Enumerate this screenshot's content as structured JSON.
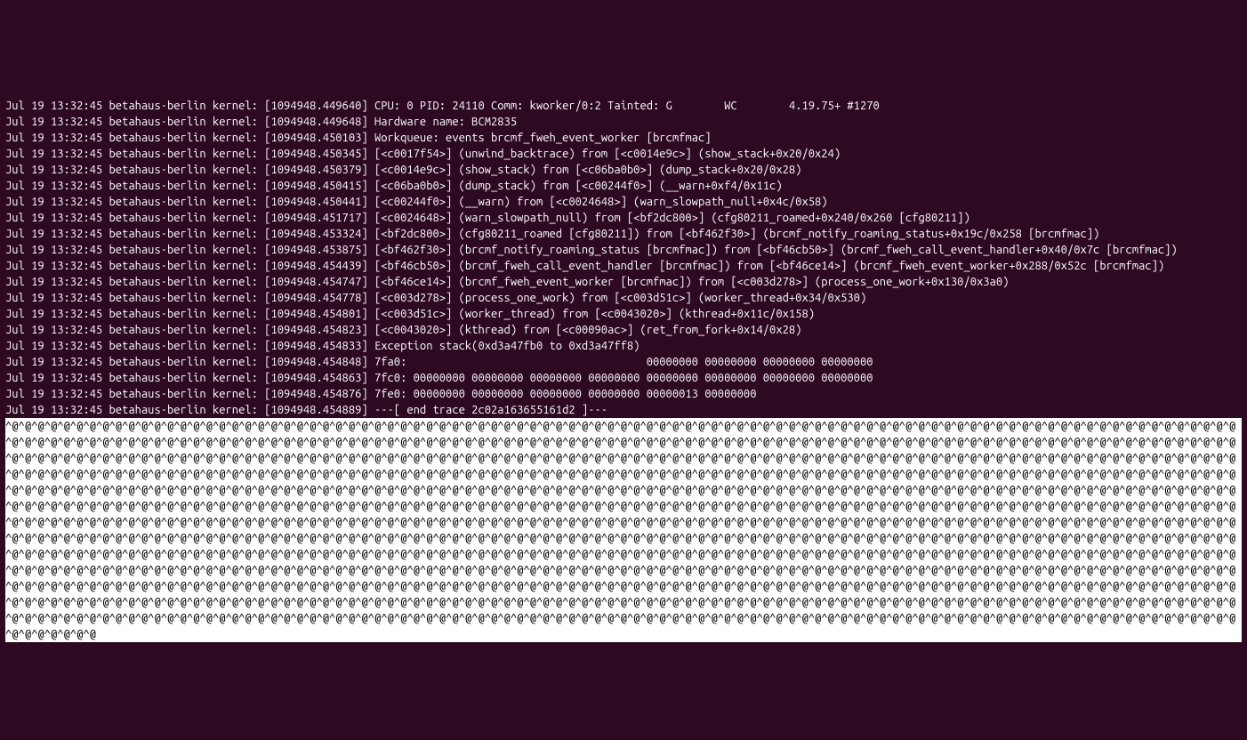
{
  "log_lines": [
    "Jul 19 13:32:45 betahaus-berlin kernel: [1094948.449640] CPU: 0 PID: 24110 Comm: kworker/0:2 Tainted: G        WC        4.19.75+ #1270",
    "Jul 19 13:32:45 betahaus-berlin kernel: [1094948.449648] Hardware name: BCM2835",
    "Jul 19 13:32:45 betahaus-berlin kernel: [1094948.450103] Workqueue: events brcmf_fweh_event_worker [brcmfmac]",
    "Jul 19 13:32:45 betahaus-berlin kernel: [1094948.450345] [<c0017f54>] (unwind_backtrace) from [<c0014e9c>] (show_stack+0x20/0x24)",
    "Jul 19 13:32:45 betahaus-berlin kernel: [1094948.450379] [<c0014e9c>] (show_stack) from [<c06ba0b0>] (dump_stack+0x20/0x28)",
    "Jul 19 13:32:45 betahaus-berlin kernel: [1094948.450415] [<c06ba0b0>] (dump_stack) from [<c00244f0>] (__warn+0xf4/0x11c)",
    "Jul 19 13:32:45 betahaus-berlin kernel: [1094948.450441] [<c00244f0>] (__warn) from [<c0024648>] (warn_slowpath_null+0x4c/0x58)",
    "Jul 19 13:32:45 betahaus-berlin kernel: [1094948.451717] [<c0024648>] (warn_slowpath_null) from [<bf2dc800>] (cfg80211_roamed+0x240/0x260 [cfg80211])",
    "Jul 19 13:32:45 betahaus-berlin kernel: [1094948.453324] [<bf2dc800>] (cfg80211_roamed [cfg80211]) from [<bf462f30>] (brcmf_notify_roaming_status+0x19c/0x258 [brcmfmac])",
    "Jul 19 13:32:45 betahaus-berlin kernel: [1094948.453875] [<bf462f30>] (brcmf_notify_roaming_status [brcmfmac]) from [<bf46cb50>] (brcmf_fweh_call_event_handler+0x40/0x7c [brcmfmac])",
    "Jul 19 13:32:45 betahaus-berlin kernel: [1094948.454439] [<bf46cb50>] (brcmf_fweh_call_event_handler [brcmfmac]) from [<bf46ce14>] (brcmf_fweh_event_worker+0x288/0x52c [brcmfmac])",
    "Jul 19 13:32:45 betahaus-berlin kernel: [1094948.454747] [<bf46ce14>] (brcmf_fweh_event_worker [brcmfmac]) from [<c003d278>] (process_one_work+0x130/0x3a0)",
    "Jul 19 13:32:45 betahaus-berlin kernel: [1094948.454778] [<c003d278>] (process_one_work) from [<c003d51c>] (worker_thread+0x34/0x530)",
    "Jul 19 13:32:45 betahaus-berlin kernel: [1094948.454801] [<c003d51c>] (worker_thread) from [<c0043020>] (kthread+0x11c/0x158)",
    "Jul 19 13:32:45 betahaus-berlin kernel: [1094948.454823] [<c0043020>] (kthread) from [<c00090ac>] (ret_from_fork+0x14/0x28)",
    "Jul 19 13:32:45 betahaus-berlin kernel: [1094948.454833] Exception stack(0xd3a47fb0 to 0xd3a47ff8)",
    "Jul 19 13:32:45 betahaus-berlin kernel: [1094948.454848] 7fa0:                                     00000000 00000000 00000000 00000000",
    "Jul 19 13:32:45 betahaus-berlin kernel: [1094948.454863] 7fc0: 00000000 00000000 00000000 00000000 00000000 00000000 00000000 00000000",
    "Jul 19 13:32:45 betahaus-berlin kernel: [1094948.454876] 7fe0: 00000000 00000000 00000000 00000000 00000013 00000000",
    "Jul 19 13:32:45 betahaus-berlin kernel: [1094948.454889] ---[ end trace 2c02a163655161d2 ]---"
  ],
  "input_pattern_unit": "^@",
  "input_pattern_repeat": 1242
}
